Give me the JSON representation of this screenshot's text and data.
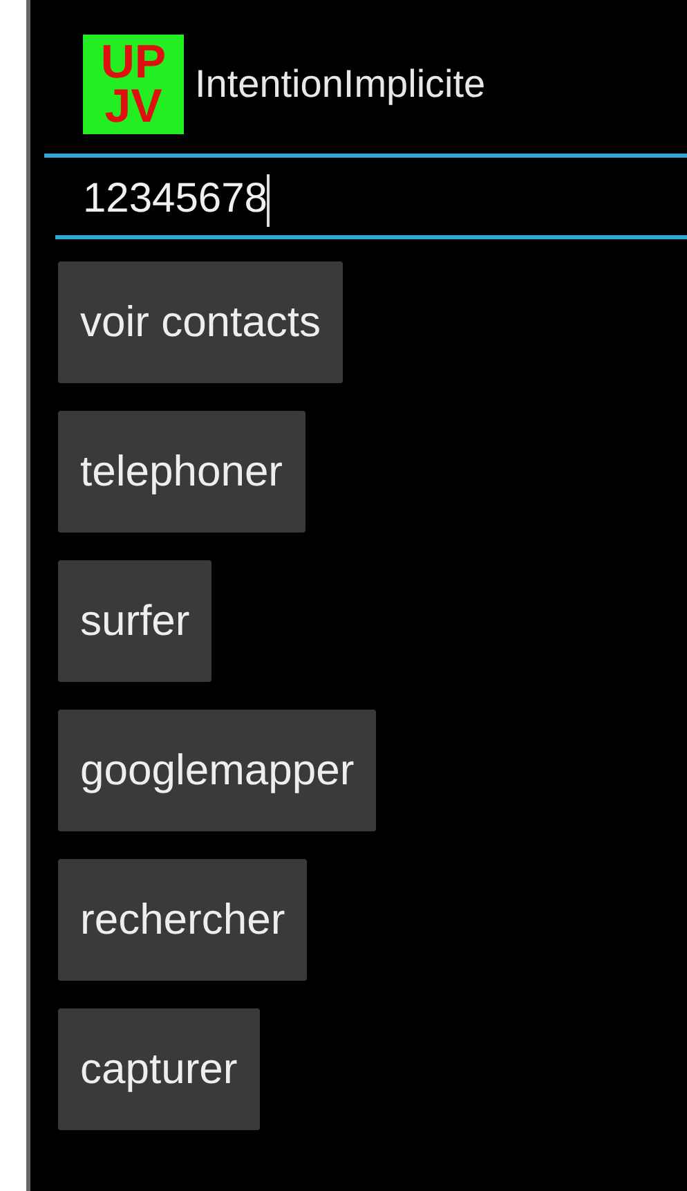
{
  "action_bar": {
    "logo": {
      "lines": [
        "UP",
        "JV"
      ]
    },
    "title": "IntentionImplicite"
  },
  "phone_field": {
    "value": "12345678"
  },
  "buttons": [
    "voir contacts",
    "telephoner",
    "surfer",
    "googlemapper",
    "rechercher",
    "capturer"
  ]
}
